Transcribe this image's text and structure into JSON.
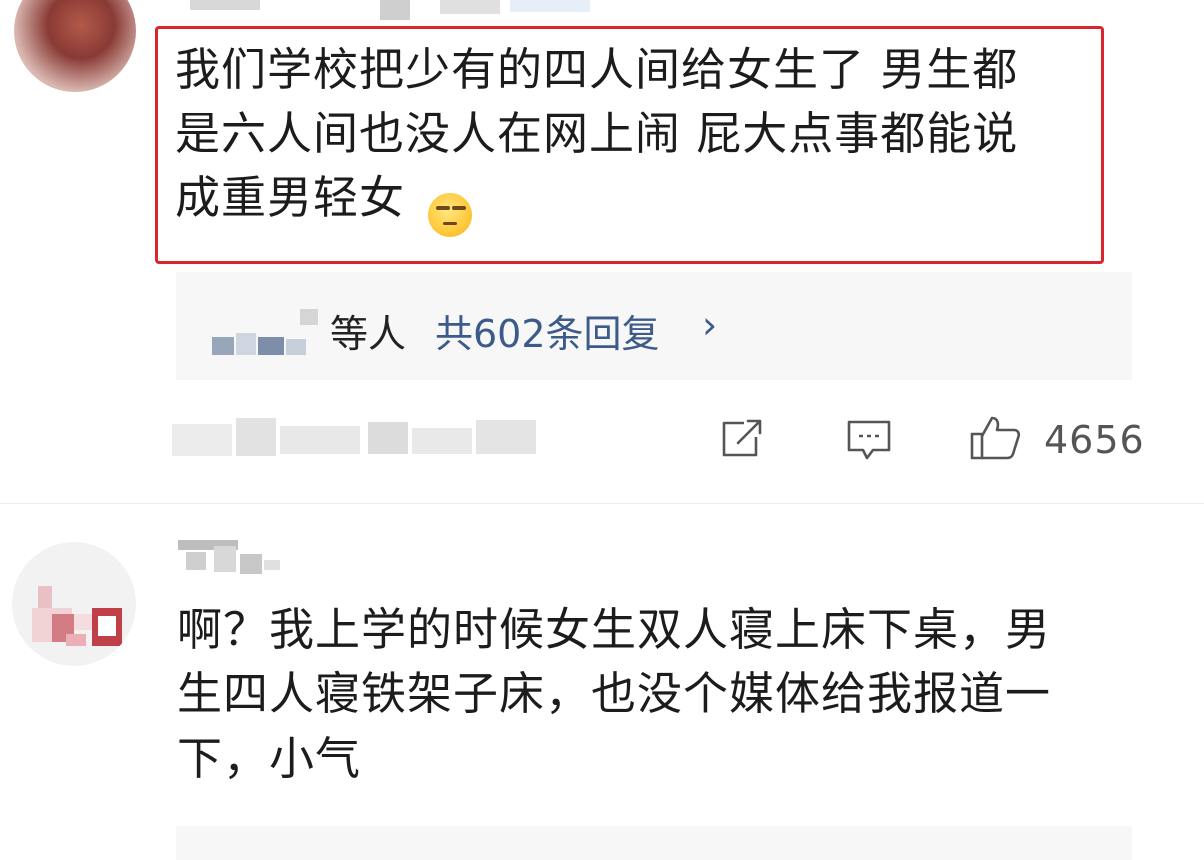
{
  "comment1": {
    "lines": [
      "我们学校把少有的四人间给女生了 男生都",
      "是六人间也没人在网上闹 屁大点事都能说",
      "成重男轻女"
    ],
    "emoji": "smirk-face-emoji",
    "replies": {
      "names_suffix": "等人",
      "count_label": "共602条回复",
      "chevron": "›"
    },
    "actions": {
      "share_icon": "share-icon",
      "comment_icon": "comment-icon",
      "like_icon": "thumbs-up-icon",
      "like_count": "4656"
    }
  },
  "comment2": {
    "lines": [
      "啊？我上学的时候女生双人寝上床下桌，男",
      "生四人寝铁架子床，也没个媒体给我报道一",
      "下，小气"
    ]
  },
  "colors": {
    "highlight_border": "#d9262d",
    "link_blue": "#3c5a8a",
    "reply_panel_bg": "#f7f7f7"
  }
}
